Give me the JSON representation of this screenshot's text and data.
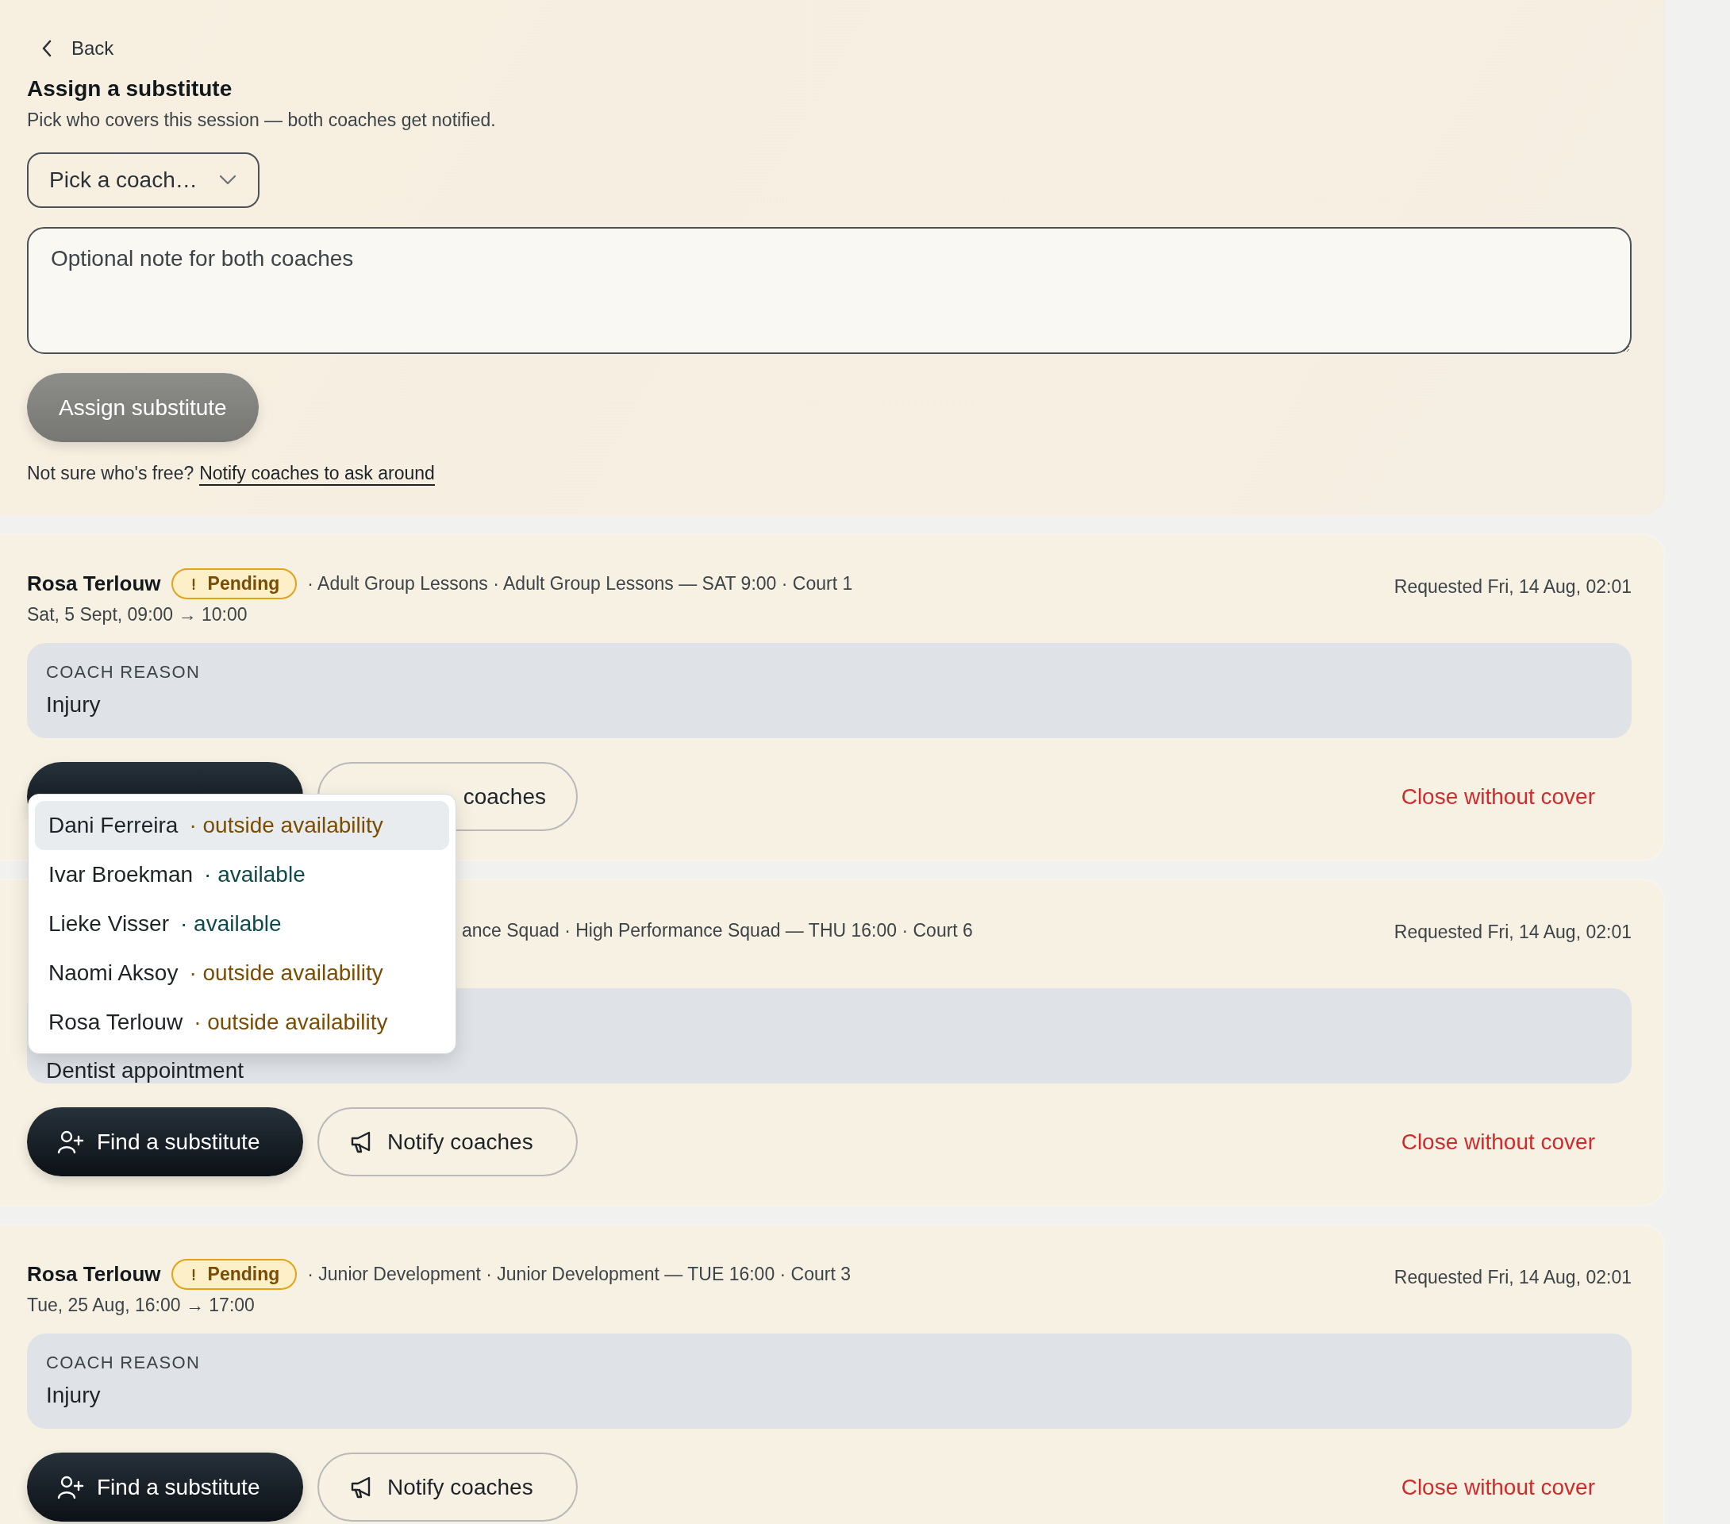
{
  "back": "Back",
  "assign": {
    "title": "Assign a substitute",
    "subtitle": "Pick who covers this session — both coaches get notified.",
    "select": {
      "placeholder": "Pick a coach…"
    },
    "note": {
      "placeholder": "Optional note for both coaches"
    },
    "button": {
      "label": "Assign substitute",
      "disabled": true
    },
    "help": "Not sure who's free?",
    "link": "Notify coaches to ask around"
  },
  "requests": [
    {
      "name": "Rosa Terlouw",
      "status": "Pending",
      "meta": "· Adult Group Lessons · Adult Group Lessons — SAT 9:00 · Court 1",
      "date": "Sat, 5 Sept, 09:00 → 10:00",
      "requested": "Requested Fri, 14 Aug, 02:01",
      "reason_label": "COACH REASON",
      "reason": "Injury",
      "actions": [
        {
          "kind": "find"
        },
        {
          "kind": "notify",
          "label": "coaches"
        }
      ],
      "close": "Close without cover",
      "menu_open": true
    },
    {
      "meta": "ance Squad · High Performance Squad — THU 16:00 · Court 6",
      "requested": "Requested Fri, 14 Aug, 02:01",
      "reason": "Dentist appointment",
      "actions": [
        {
          "kind": "find",
          "label": "Find a substitute"
        },
        {
          "kind": "notify",
          "label": "Notify coaches"
        }
      ],
      "close": "Close without cover",
      "menu_open": false
    },
    {
      "name": "Rosa Terlouw",
      "status": "Pending",
      "meta": "· Junior Development · Junior Development — TUE 16:00 · Court 3",
      "date": "Tue, 25 Aug, 16:00 → 17:00",
      "requested": "Requested Fri, 14 Aug, 02:01",
      "reason_label": "COACH REASON",
      "reason": "Injury",
      "actions": [
        {
          "kind": "find",
          "label": "Find a substitute"
        },
        {
          "kind": "notify",
          "label": "Notify coaches"
        }
      ],
      "close": "Close without cover",
      "menu_open": false
    }
  ],
  "coach_menu": {
    "items": [
      {
        "name": "Dani Ferreira",
        "availability": "· outside availability",
        "kind": "outside",
        "selected": true
      },
      {
        "name": "Ivar Broekman",
        "availability": "· available",
        "kind": "available",
        "selected": false
      },
      {
        "name": "Lieke Visser",
        "availability": "· available",
        "kind": "available",
        "selected": false
      },
      {
        "name": "Naomi Aksoy",
        "availability": "· outside availability",
        "kind": "outside",
        "selected": false
      },
      {
        "name": "Rosa Terlouw",
        "availability": "· outside availability",
        "kind": "outside",
        "selected": false
      }
    ]
  }
}
